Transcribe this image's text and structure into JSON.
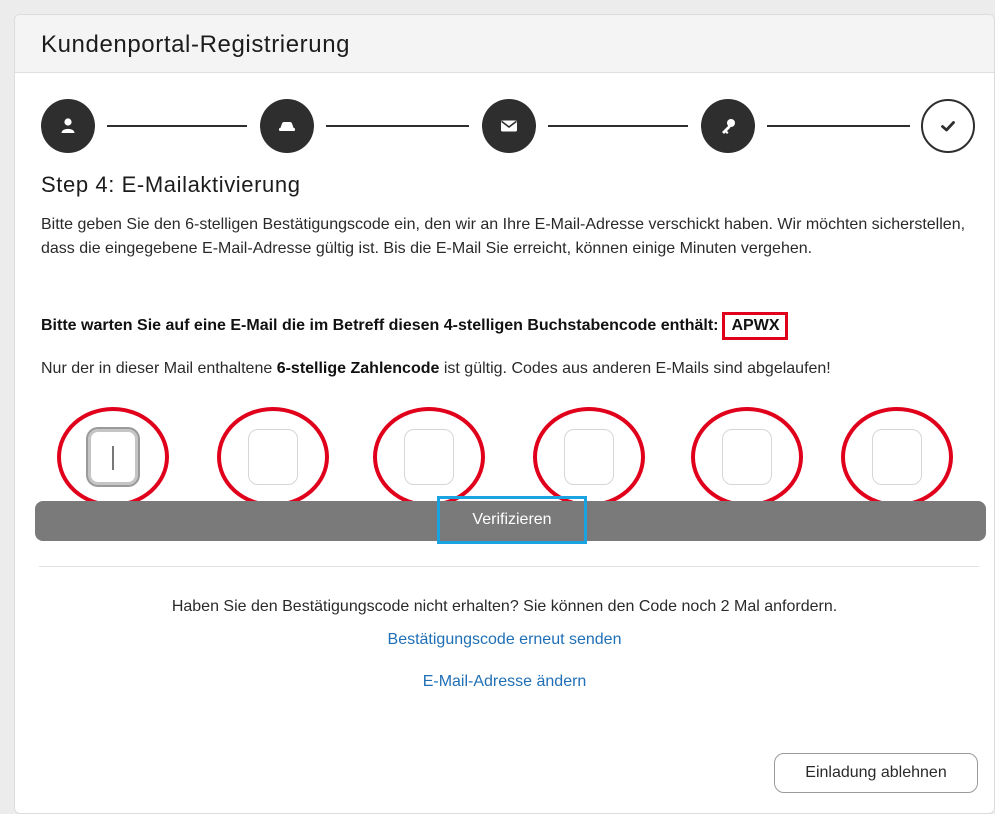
{
  "header": {
    "title": "Kundenportal-Registrierung"
  },
  "stepper": {
    "steps": [
      {
        "icon": "user-icon",
        "state": "completed"
      },
      {
        "icon": "car-icon",
        "state": "completed"
      },
      {
        "icon": "envelope-icon",
        "state": "current"
      },
      {
        "icon": "key-icon",
        "state": "upcoming"
      },
      {
        "icon": "check-icon",
        "state": "upcoming"
      }
    ]
  },
  "step": {
    "title": "Step 4: E-Mailaktivierung",
    "intro": "Bitte geben Sie den 6-stelligen Bestätigungscode ein, den wir an Ihre E-Mail-Adresse verschickt haben. Wir möchten sicherstellen, dass die eingegebene E-Mail-Adresse gültig ist. Bis die E-Mail Sie erreicht, können einige Minuten vergehen.",
    "notice_text": "Bitte warten Sie auf eine E-Mail die im Betreff diesen 4-stelligen Buchstabencode enthält:",
    "subject_code": "APWX",
    "hint_prefix": "Nur der in dieser Mail enthaltene ",
    "hint_bold": "6-stellige Zahlencode",
    "hint_suffix": " ist gültig. Codes aus anderen E-Mails sind abgelaufen!"
  },
  "code_inputs": [
    "",
    "",
    "",
    "",
    "",
    ""
  ],
  "verify_button": "Verifizieren",
  "resend": {
    "info": "Haben Sie den Bestätigungscode nicht erhalten? Sie können den Code noch 2 Mal anfordern.",
    "resend_link": "Bestätigungscode erneut senden",
    "change_email_link": "E-Mail-Adresse ändern"
  },
  "decline_button": "Einladung ablehnen",
  "colors": {
    "annotation_red": "#e0001b",
    "annotation_blue": "#1aa3e0",
    "link": "#1f6fb6",
    "step_dark": "#2e2e2e",
    "verify_bar": "#7a7a7a"
  }
}
